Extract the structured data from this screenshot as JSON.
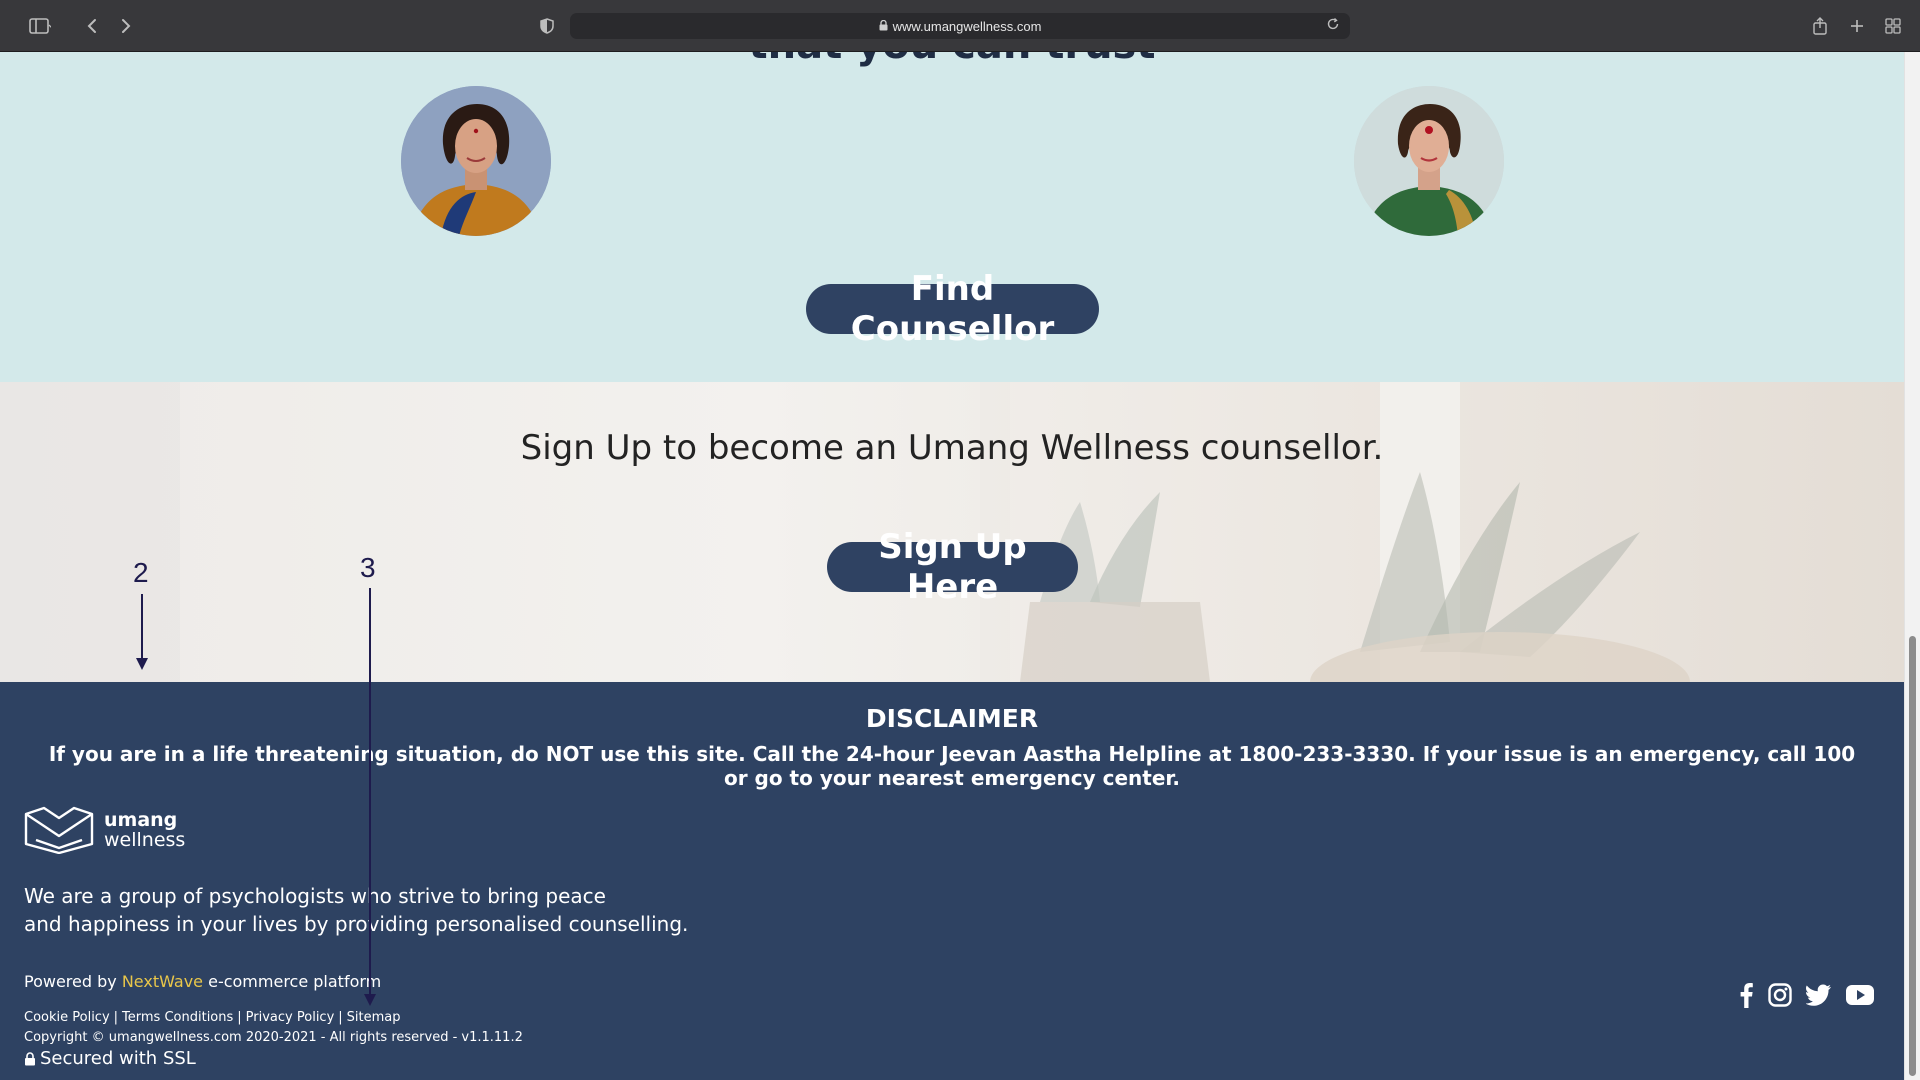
{
  "browser": {
    "url": "www.umangwellness.com"
  },
  "counsellors": {
    "cut_heading": "that you can trust",
    "find_button": "Find Counsellor"
  },
  "signup": {
    "title": "Sign Up to become an Umang Wellness counsellor.",
    "button": "Sign Up Here"
  },
  "annotations": {
    "label_2": "2",
    "label_3": "3"
  },
  "footer": {
    "disclaimer_title": "DISCLAIMER",
    "disclaimer_text": "If you are in a life threatening situation, do NOT use this site. Call the 24-hour Jeevan Aastha Helpline at 1800-233-3330. If your issue is an emergency, call 100 or go to your nearest emergency center.",
    "logo_line1": "umang",
    "logo_line2": "wellness",
    "about_line1": "We are a group of psychologists who strive to bring peace",
    "about_line2": "and happiness in your lives by providing personalised counselling.",
    "powered_prefix": "Powered by ",
    "powered_brand": "NextWave",
    "powered_suffix": " e-commerce platform",
    "links": [
      "Cookie Policy",
      "Terms Conditions",
      "Privacy Policy",
      "Sitemap"
    ],
    "link_separator": "|",
    "copyright": "Copyright © umangwellness.com 2020-2021 - All rights reserved - v1.1.11.2",
    "ssl": "Secured with SSL",
    "social_icons": [
      "facebook-icon",
      "instagram-icon",
      "twitter-icon",
      "youtube-icon"
    ]
  },
  "colors": {
    "counsellor_bg": "#d3e9ea",
    "button_bg": "#2f4262",
    "footer_bg": "#2e4262",
    "brand_accent": "#e8c64a",
    "annotation": "#1e1b4d"
  }
}
